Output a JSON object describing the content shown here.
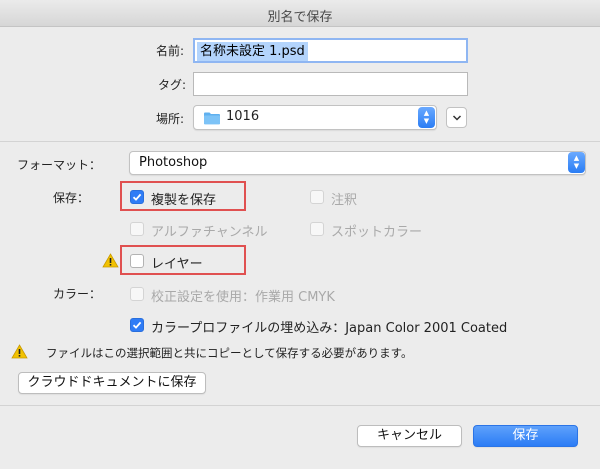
{
  "dialog": {
    "title": "別名で保存"
  },
  "name_field": {
    "label": "名前:",
    "value": "名称未設定 1.psd"
  },
  "tags_field": {
    "label": "タグ:",
    "value": ""
  },
  "location": {
    "label": "場所:",
    "value": "1016"
  },
  "format": {
    "label": "フォーマット：",
    "value": "Photoshop"
  },
  "save_section": {
    "label": "保存：",
    "options": [
      {
        "label": "複製を保存",
        "checked": true,
        "enabled": true
      },
      {
        "label": "注釈",
        "checked": false,
        "enabled": false
      },
      {
        "label": "アルファチャンネル",
        "checked": false,
        "enabled": false
      },
      {
        "label": "スポットカラー",
        "checked": false,
        "enabled": false
      },
      {
        "label": "レイヤー",
        "checked": false,
        "enabled": true
      }
    ]
  },
  "color_section": {
    "label": "カラー：",
    "options": [
      {
        "label": "校正設定を使用：作業用 CMYK",
        "checked": false,
        "enabled": false
      },
      {
        "label": "カラープロファイルの埋め込み：Japan Color 2001 Coated",
        "checked": true,
        "enabled": true
      }
    ]
  },
  "warning_message": "ファイルはこの選択範囲と共にコピーとして保存する必要があります。",
  "buttons": {
    "cloud_save": "クラウドドキュメントに保存",
    "cancel": "キャンセル",
    "save": "保存"
  },
  "colors": {
    "accent": "#2f7cf6",
    "highlight": "#e05050",
    "warning": "#e8b400"
  },
  "icons": {
    "folder": "folder-icon",
    "warning": "warning-icon",
    "chevron": "chevron-down-icon",
    "stepper": "stepper-icon"
  }
}
